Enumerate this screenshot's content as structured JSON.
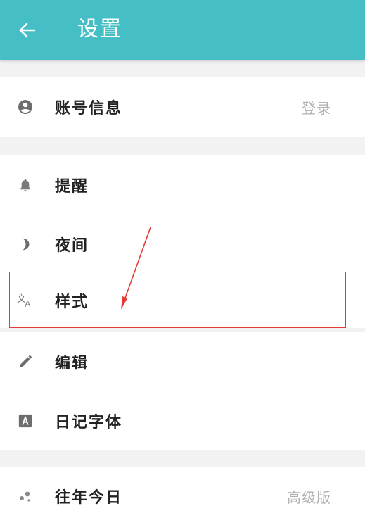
{
  "header": {
    "title": "设置",
    "back_icon": "arrow-left-icon",
    "background_color": "#45bec6"
  },
  "sections": {
    "account": {
      "label": "账号信息",
      "trailing": "登录",
      "icon": "account-circle-icon"
    },
    "items": [
      {
        "label": "提醒",
        "icon": "bell-icon"
      },
      {
        "label": "夜间",
        "icon": "moon-icon"
      },
      {
        "label": "样式",
        "icon": "translate-icon"
      },
      {
        "label": "编辑",
        "icon": "pencil-icon"
      },
      {
        "label": "日记字体",
        "icon": "font-a-icon"
      }
    ],
    "history": {
      "label": "往年今日",
      "trailing": "高级版",
      "icon": "bubbles-icon"
    }
  },
  "annotation": {
    "highlight_color": "#e53935",
    "highlighted_item": "样式"
  }
}
